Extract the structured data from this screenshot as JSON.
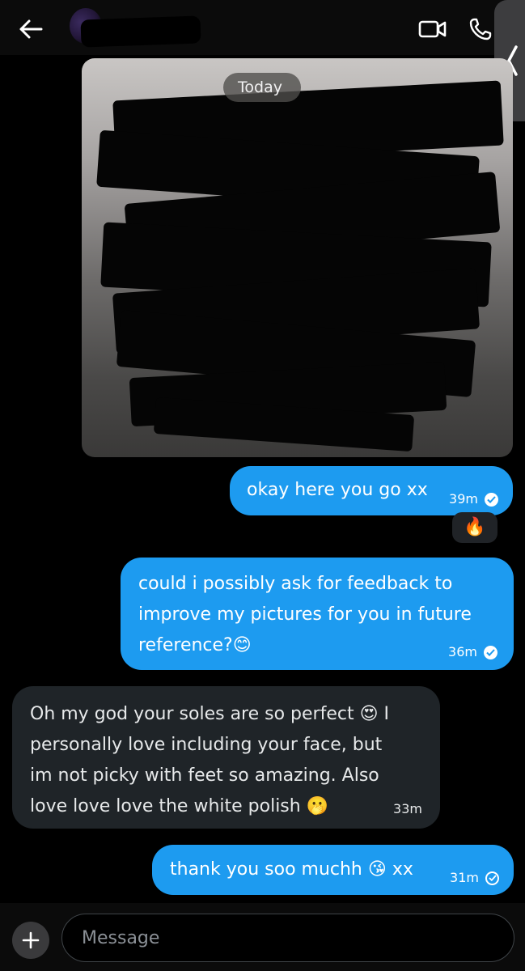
{
  "header": {
    "back_icon": "arrow-left-icon",
    "contact_name_redacted": true,
    "video_icon": "video-camera-icon",
    "call_icon": "phone-icon",
    "side_tab_icon": "chevron-left-icon"
  },
  "media": {
    "date_label": "Today"
  },
  "messages": [
    {
      "direction": "out",
      "text": "okay here you go xx",
      "time": "39m",
      "status": "read",
      "reaction": "🔥"
    },
    {
      "direction": "out",
      "text_lines": [
        "could i possibly ask for feedback to",
        "improve my pictures for you in future",
        "reference?"
      ],
      "emoji": "😊",
      "time": "36m",
      "status": "read"
    },
    {
      "direction": "in",
      "text_lines": [
        "Oh my god your soles are so perfect",
        "personally love including your face, but",
        "im not picky with feet so amazing. Also",
        "love love love the white polish"
      ],
      "line1_emoji": "😍",
      "line1_suffix": "I",
      "line4_emoji": "🫢",
      "time": "33m"
    },
    {
      "direction": "out",
      "text": "thank you soo muchh",
      "emoji": "😘",
      "suffix": "xx",
      "time": "31m",
      "status": "sent"
    }
  ],
  "composer": {
    "add_icon": "plus-icon",
    "placeholder": "Message"
  },
  "colors": {
    "outgoing_bubble": "#1d9bf0",
    "incoming_bubble": "#1f2428",
    "background": "#000000"
  }
}
